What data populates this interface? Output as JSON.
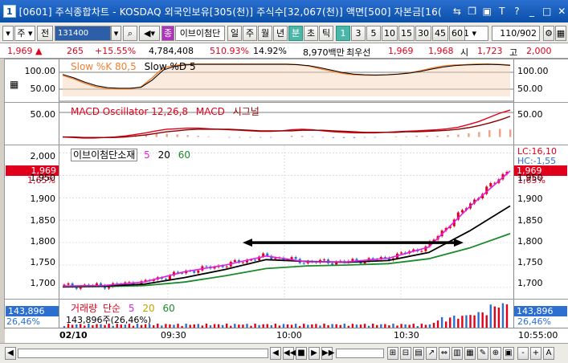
{
  "window": {
    "icon_label": "1",
    "title": "[0601] 주식종합차트 - KOSDAQ 외국인보유[305(천)] 주식수[32,067(천)] 액면[500] 자본금[16("
  },
  "toolbar": {
    "market_select": "주",
    "full_label": "전",
    "code_value": "131400",
    "stock_name": "이브이첨단",
    "stock_prefix": "종",
    "period_buttons": [
      "일",
      "주",
      "월",
      "년",
      "분",
      "초",
      "틱"
    ],
    "selected_period": "분",
    "interval_buttons": [
      "1",
      "3",
      "5",
      "10",
      "15",
      "30",
      "45",
      "60"
    ],
    "selected_interval": "1",
    "unit_value": "1",
    "count_display": "110/902"
  },
  "quote": {
    "price": "1,969",
    "change": "265",
    "change_pct": "+15.55%",
    "volume": "4,784,408",
    "volume_ratio": "510.93%",
    "turnover_pct": "14.92%",
    "amount": "8,970백만",
    "best_label": "최우선",
    "ask": "1,969",
    "bid": "1,968",
    "open_label": "시",
    "open": "1,723",
    "high_label": "고",
    "high": "2,000"
  },
  "stochastic": {
    "legend_k": "Slow %K 80,5",
    "legend_d": "Slow %D 5",
    "axis_labels": [
      "100.00",
      "50.00"
    ],
    "chart_data": {
      "type": "line",
      "series": [
        {
          "name": "Slow %K 80,5",
          "color": "#f08030",
          "values": [
            62,
            52,
            38,
            28,
            23,
            22,
            22,
            28,
            55,
            85,
            92,
            95,
            96,
            96,
            96,
            96,
            96,
            96,
            96,
            96,
            96,
            94,
            90,
            82,
            75,
            68,
            64,
            63,
            63,
            64,
            66,
            70,
            76,
            84,
            90,
            93,
            94,
            96,
            96,
            95,
            93
          ]
        },
        {
          "name": "Slow %D 5",
          "color": "#000000",
          "values": [
            65,
            55,
            42,
            32,
            26,
            24,
            24,
            27,
            48,
            78,
            89,
            93,
            95,
            95,
            95,
            95,
            95,
            95,
            95,
            95,
            95,
            94,
            91,
            85,
            78,
            71,
            66,
            64,
            63,
            64,
            66,
            69,
            74,
            81,
            87,
            91,
            93,
            94,
            95,
            94,
            92
          ]
        }
      ],
      "ylim": [
        0,
        100
      ]
    }
  },
  "macd": {
    "legend_osc": "MACD Oscillator 12,26,8",
    "legend_macd": "MACD",
    "legend_signal": "시그널",
    "axis_labels": [
      "50.00",
      "0.00"
    ],
    "chart_data": {
      "type": "line",
      "series": [
        {
          "name": "MACD",
          "color": "#e0001b",
          "values": [
            0,
            -1,
            -2,
            -2,
            -1,
            0,
            2,
            5,
            8,
            12,
            15,
            16,
            17,
            17,
            16,
            15,
            14,
            13,
            12,
            11,
            11,
            12,
            14,
            15,
            14,
            12,
            10,
            9,
            8,
            8,
            8,
            9,
            10,
            11,
            12,
            13,
            14,
            16,
            19,
            24,
            30,
            38,
            46,
            52
          ]
        },
        {
          "name": "시그널",
          "color": "#8b0000",
          "values": [
            0,
            0,
            -1,
            -1,
            -1,
            -1,
            0,
            2,
            4,
            7,
            10,
            12,
            14,
            15,
            15,
            15,
            15,
            14,
            13,
            12,
            12,
            12,
            12,
            13,
            13,
            13,
            12,
            11,
            10,
            9,
            9,
            9,
            9,
            10,
            10,
            11,
            12,
            13,
            15,
            18,
            22,
            27,
            33,
            40
          ]
        }
      ],
      "ylim": [
        -10,
        60
      ]
    }
  },
  "price_panel": {
    "legend_name": "이브이첨단소재",
    "legend_ma": [
      "5",
      "20",
      "60"
    ],
    "axis_labels": [
      "2,000",
      "1,950",
      "1,900",
      "1,850",
      "1,800",
      "1,750",
      "1,700"
    ],
    "price_badge": "1,969",
    "pct_badge": "1,65%",
    "right_lc": "LC:16,10",
    "right_hc": "HC:-1,55",
    "chart_data": {
      "type": "line",
      "x": [
        "09:10",
        "09:20",
        "09:30",
        "09:40",
        "09:50",
        "10:00",
        "10:10",
        "10:20",
        "10:30",
        "10:40",
        "10:50",
        "10:55"
      ],
      "series": [
        {
          "name": "5",
          "color": "#e020e0",
          "values": [
            1703,
            1704,
            1712,
            1735,
            1750,
            1770,
            1757,
            1757,
            1765,
            1790,
            1880,
            1960
          ]
        },
        {
          "name": "20",
          "color": "#000000",
          "values": [
            1702,
            1703,
            1707,
            1722,
            1740,
            1762,
            1758,
            1756,
            1760,
            1778,
            1826,
            1882
          ]
        },
        {
          "name": "60",
          "color": "#1a8a2a",
          "values": [
            1701,
            1702,
            1704,
            1712,
            1726,
            1742,
            1748,
            1750,
            1753,
            1764,
            1788,
            1820
          ]
        }
      ],
      "annotation": "arrow 1,800 (09:53 ~ 10:46)",
      "ylim": [
        1680,
        2010
      ]
    }
  },
  "volume_panel": {
    "legend_name": "거래량",
    "legend_simple": "단순",
    "legend_ma": [
      "5",
      "20",
      "60"
    ],
    "value_text": "143,896주(26,46%)",
    "badge_value": "143,896",
    "badge_pct": "26,46%"
  },
  "time_axis": {
    "date_label": "02/10",
    "ticks": [
      "09:30",
      "10:00",
      "10:30"
    ],
    "last_time": "10:55:00"
  },
  "scrollbar": {
    "buttons": [
      "◀",
      "◀◀",
      "■",
      "▶",
      "▶▶"
    ],
    "zoom": [
      "-",
      "+",
      "A"
    ]
  }
}
